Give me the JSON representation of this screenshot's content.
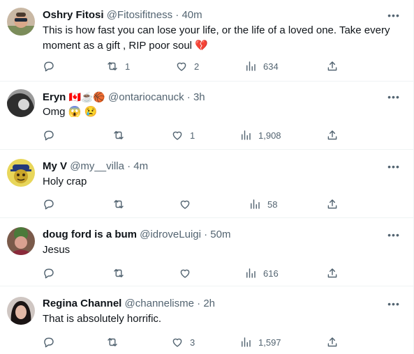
{
  "tweets": [
    {
      "name": "Oshry Fitosi",
      "handle": "@Fitosifitness",
      "dot": "·",
      "time": "40m",
      "text_line1": "This is how fast you can lose your life, or the life of a loved one. Take every",
      "text_line2": "moment as a gift , RIP poor soul 💔",
      "retweets": "1",
      "likes": "2",
      "views": "634"
    },
    {
      "name": "Eryn",
      "name_emoji": "🇨🇦☕🏀",
      "handle": "@ontariocanuck",
      "dot": "·",
      "time": "3h",
      "text_line1": "Omg 😱 😢",
      "retweets": "",
      "likes": "1",
      "views": "1,908"
    },
    {
      "name": "My V",
      "handle": "@my__villa",
      "dot": "·",
      "time": "4m",
      "text_line1": "Holy crap",
      "retweets": "",
      "likes": "",
      "views": "58"
    },
    {
      "name": "doug ford is a bum",
      "handle": "@idroveLuigi",
      "dot": "·",
      "time": "50m",
      "text_line1": "Jesus",
      "retweets": "",
      "likes": "",
      "views": "616"
    },
    {
      "name": "Regina Channel",
      "handle": "@channelisme",
      "dot": "·",
      "time": "2h",
      "text_line1": "That is absolutely horrific.",
      "retweets": "",
      "likes": "3",
      "views": "1,597"
    }
  ],
  "more_glyph": "•••",
  "icons": [
    "reply-icon",
    "retweet-icon",
    "like-icon",
    "views-icon",
    "share-icon",
    "more-icon"
  ],
  "colors": {
    "text": "#0f1419",
    "secondary": "#536471",
    "divider": "#eff3f4"
  }
}
